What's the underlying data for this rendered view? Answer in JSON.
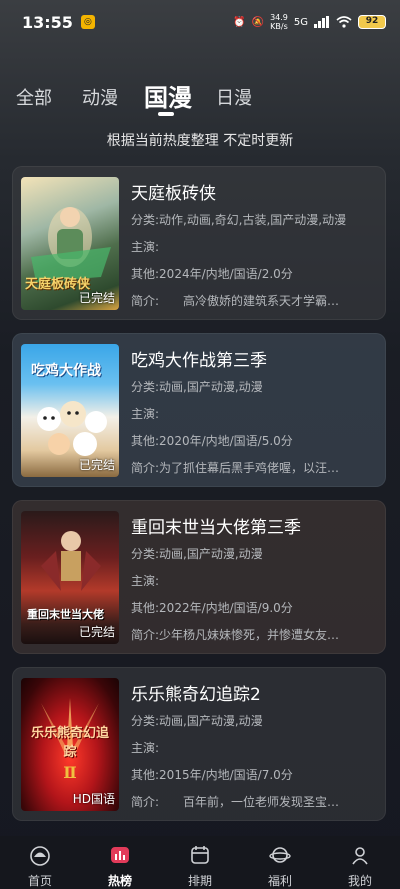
{
  "status": {
    "time": "13:55",
    "speed_value": "34.9",
    "speed_unit": "KB/s",
    "signal": "5G",
    "battery": "92"
  },
  "tabs": [
    "全部",
    "动漫",
    "国漫",
    "日漫"
  ],
  "subtitle": "根据当前热度整理 不定时更新",
  "labels": {
    "category": "分类:",
    "cast": "主演:",
    "other": "其他:",
    "intro": "简介:"
  },
  "items": [
    {
      "title": "天庭板砖侠",
      "category": "动作,动画,奇幻,古装,国产动漫,动漫",
      "cast": "",
      "other": "2024年/内地/国语/2.0分",
      "intro": "　　高冷傲娇的建筑系天才学霸…",
      "badge": "已完结",
      "poster_text": "天庭板砖侠"
    },
    {
      "title": "吃鸡大作战第三季",
      "category": "动画,国产动漫,动漫",
      "cast": "",
      "other": "2020年/内地/国语/5.0分",
      "intro": "为了抓住幕后黑手鸡佬喔，以汪…",
      "badge": "已完结",
      "poster_text": "吃鸡大作战"
    },
    {
      "title": "重回末世当大佬第三季",
      "category": "动画,国产动漫,动漫",
      "cast": "",
      "other": "2022年/内地/国语/9.0分",
      "intro": "少年杨凡妹妹惨死，并惨遭女友…",
      "badge": "已完结",
      "poster_text": "重回末世当大佬"
    },
    {
      "title": "乐乐熊奇幻追踪2",
      "category": "动画,国产动漫,动漫",
      "cast": "",
      "other": "2015年/内地/国语/7.0分",
      "intro": "　　百年前，一位老师发现圣宝…",
      "badge": "HD国语",
      "poster_text": "乐乐熊奇幻追踪"
    }
  ],
  "nav": [
    "首页",
    "热榜",
    "排期",
    "福利",
    "我的"
  ]
}
